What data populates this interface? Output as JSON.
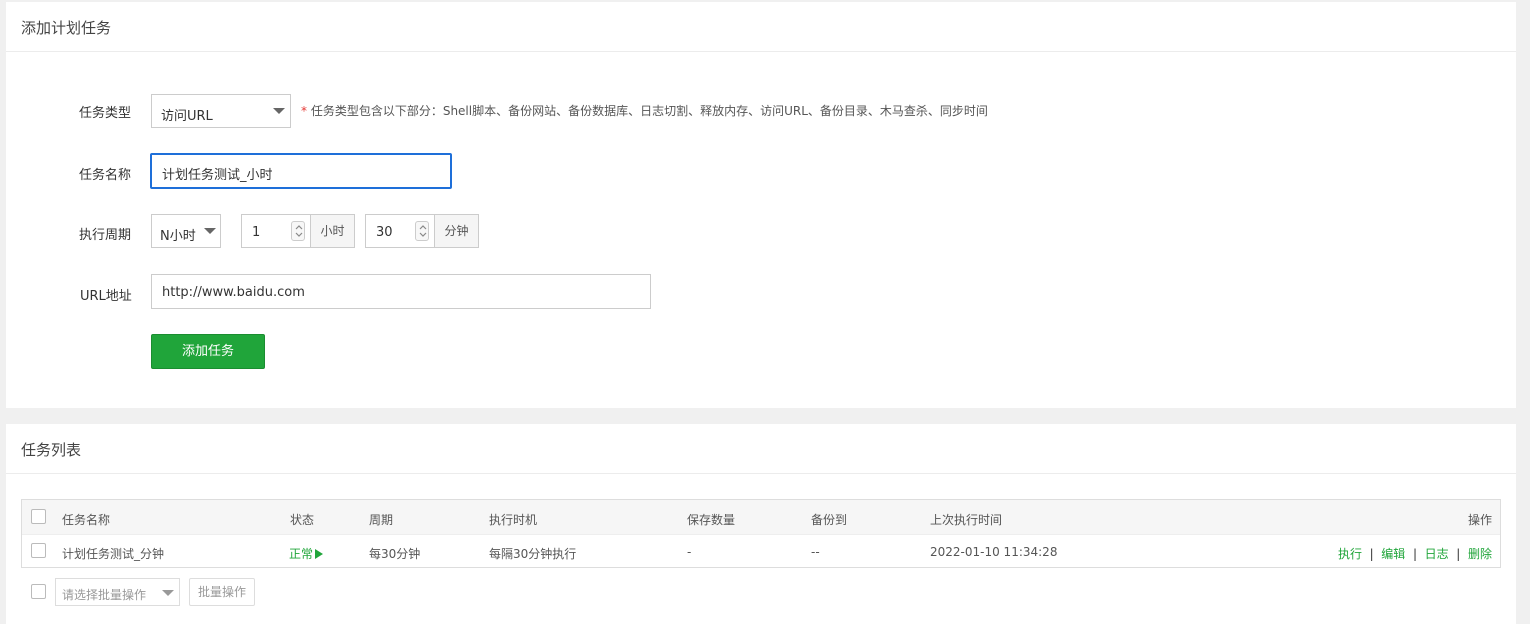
{
  "add_panel": {
    "title": "添加计划任务",
    "task_type": {
      "label": "任务类型",
      "value": "访问URL",
      "hint_star": "*",
      "hint": "任务类型包含以下部分：Shell脚本、备份网站、备份数据库、日志切割、释放内存、访问URL、备份目录、木马查杀、同步时间"
    },
    "task_name": {
      "label": "任务名称",
      "value": "计划任务测试_小时"
    },
    "period": {
      "label": "执行周期",
      "mode": "N小时",
      "hours_value": "1",
      "hours_unit": "小时",
      "minutes_value": "30",
      "minutes_unit": "分钟"
    },
    "url": {
      "label": "URL地址",
      "value": "http://www.baidu.com"
    },
    "submit_label": "添加任务"
  },
  "list_panel": {
    "title": "任务列表",
    "columns": [
      "任务名称",
      "状态",
      "周期",
      "执行时机",
      "保存数量",
      "备份到",
      "上次执行时间",
      "操作"
    ],
    "rows": [
      {
        "name": "计划任务测试_分钟",
        "status": "正常",
        "status_icon": "play-triangle",
        "period": "每30分钟",
        "timing": "每隔30分钟执行",
        "keep": "-",
        "backup_to": "--",
        "last_run": "2022-01-10 11:34:28",
        "actions": [
          "执行",
          "编辑",
          "日志",
          "删除"
        ]
      }
    ],
    "batch_select_placeholder": "请选择批量操作",
    "batch_button": "批量操作"
  },
  "colors": {
    "accent_green": "#20a53a",
    "focus_blue": "#1e6fd9"
  }
}
